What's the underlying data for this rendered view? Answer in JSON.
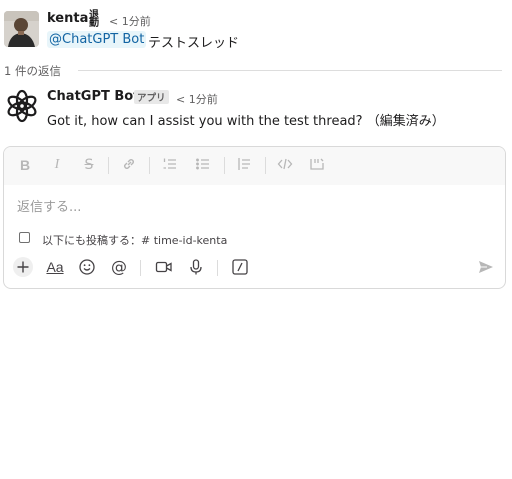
{
  "message": {
    "author": "kenta",
    "status_emoji_text": "退勤",
    "timestamp": "< 1分前",
    "mention": "@ChatGPT Bot",
    "text": "テストスレッド"
  },
  "replies": {
    "count_label": "1 件の返信"
  },
  "reply": {
    "author": "ChatGPT Bot",
    "badge": "アプリ",
    "timestamp": "< 1分前",
    "text": "Got it, how can I assist you with the test thread? （編集済み）"
  },
  "composer": {
    "placeholder": "返信する...",
    "also_post_label": "以下にも投稿する：# time-id-kenta",
    "format_label": "Aa"
  },
  "colors": {
    "mention_bg": "#e8f5fa",
    "mention_text": "#1264a3",
    "toolbar_bg": "#f8f8f8"
  },
  "icons": {
    "toolbar": [
      "bold-icon",
      "italic-icon",
      "strikethrough-icon",
      "link-icon",
      "ordered-list-icon",
      "bullet-list-icon",
      "blockquote-icon",
      "code-icon",
      "code-block-icon"
    ],
    "bottom": [
      "plus-icon",
      "format-icon",
      "emoji-icon",
      "mention-icon",
      "video-icon",
      "microphone-icon",
      "slash-command-icon",
      "send-icon"
    ]
  }
}
